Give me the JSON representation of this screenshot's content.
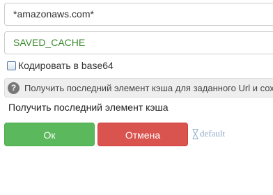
{
  "fields": {
    "url_value": "*amazonaws.com*",
    "cache_value": "SAVED_CACHE"
  },
  "checkbox": {
    "label": "Кодировать в base64",
    "checked": false
  },
  "hint": {
    "icon": "question-icon",
    "glyph": "?",
    "text": "Получить последний элемент кэша для заданного Url и сохранить"
  },
  "description": "Получить последний элемент кэша",
  "buttons": {
    "ok_label": "Ок",
    "cancel_label": "Отмена",
    "default_label": "default",
    "default_icon": "hourglass-icon"
  },
  "colors": {
    "ok": "#5cb85c",
    "cancel": "#d9534f",
    "cache_text": "#3c8a2e",
    "default_link": "#8fa8c9"
  }
}
